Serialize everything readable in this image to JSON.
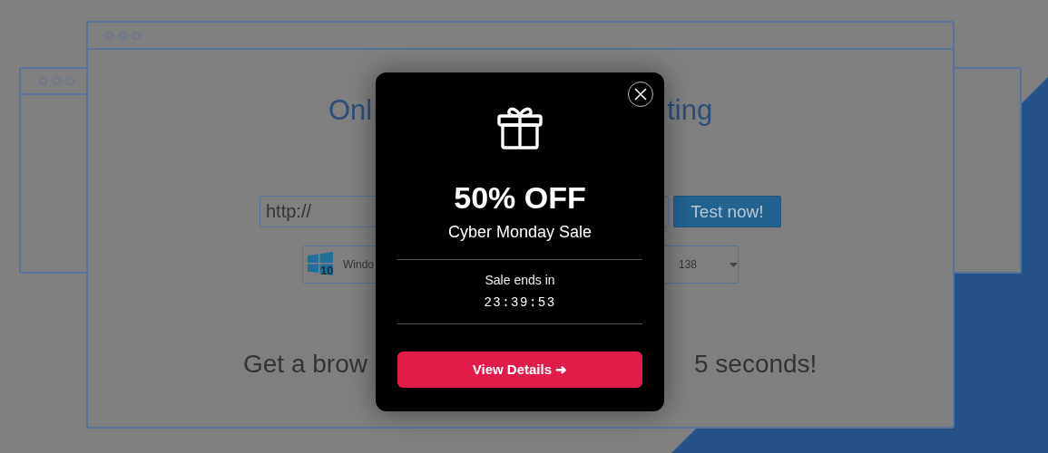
{
  "background_page": {
    "heading_fragments": [
      "Onl",
      "ting"
    ],
    "url_field": {
      "value": "http://"
    },
    "test_button": "Test now!",
    "os_select": {
      "badge": "10",
      "label": "Windo"
    },
    "version_select": {
      "label": "138"
    },
    "tagline_fragments": [
      "Get a brow",
      "5 seconds!"
    ]
  },
  "popup": {
    "title": "50% OFF",
    "subtitle": "Cyber Monday Sale",
    "countdown_label": "Sale ends in",
    "countdown": "23:39:53",
    "button": "View Details ➜"
  }
}
